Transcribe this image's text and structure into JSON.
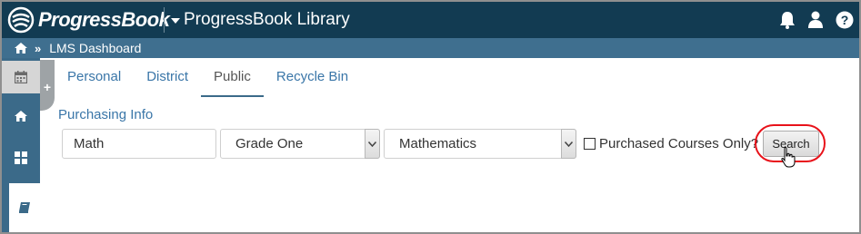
{
  "brand": {
    "name": "ProgressBook"
  },
  "app": {
    "title": "ProgressBook Library"
  },
  "header_icons": [
    "bell-icon",
    "user-icon",
    "help-icon"
  ],
  "breadcrumb": {
    "home_icon": "home-icon",
    "separator": "»",
    "current": "LMS Dashboard"
  },
  "sidebar": {
    "items": [
      {
        "name": "calendar",
        "icon": "calendar-icon"
      },
      {
        "name": "home",
        "icon": "home-icon"
      },
      {
        "name": "dashboard",
        "icon": "grid-icon"
      },
      {
        "name": "library",
        "icon": "book-icon"
      }
    ],
    "expander_label": "+"
  },
  "tabs": [
    {
      "label": "Personal",
      "active": false
    },
    {
      "label": "District",
      "active": false
    },
    {
      "label": "Public",
      "active": true
    },
    {
      "label": "Recycle Bin",
      "active": false
    }
  ],
  "filters": {
    "section_label": "Purchasing Info",
    "keyword_value": "Math",
    "grade_selected": "Grade One",
    "subject_selected": "Mathematics",
    "purchased_only_label": "Purchased Courses Only?",
    "purchased_only_checked": false,
    "search_label": "Search"
  },
  "colors": {
    "topbar": "#123b52",
    "breadcrumb_bar": "#3f6f8f",
    "sidebar": "#3b6a89",
    "link": "#3a76a8",
    "highlight_ring": "#e8121a"
  }
}
